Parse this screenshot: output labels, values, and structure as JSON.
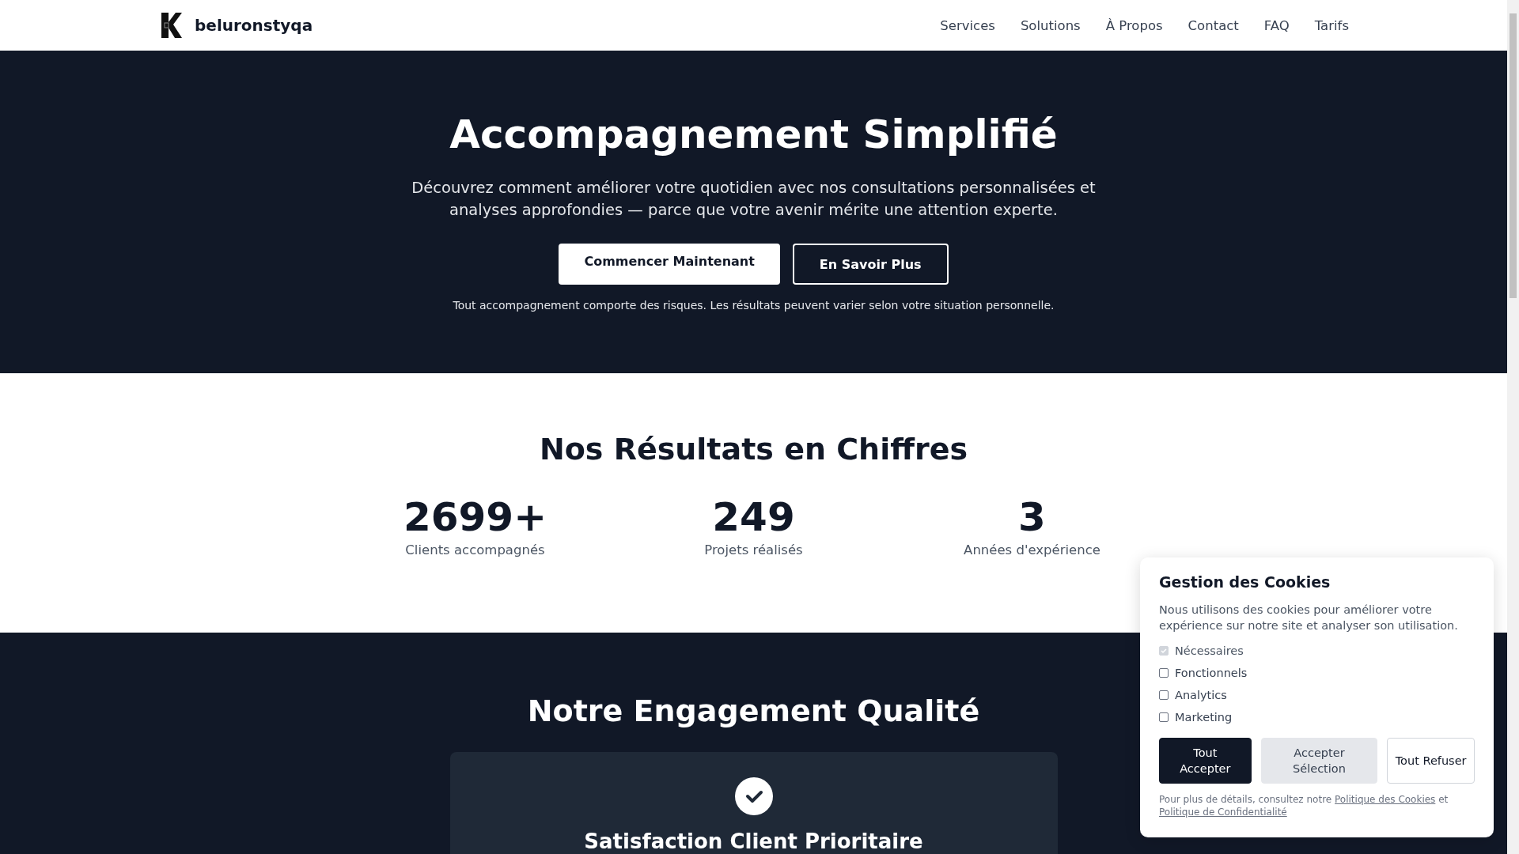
{
  "header": {
    "brand": "beluronstyqa",
    "nav": [
      "Services",
      "Solutions",
      "À Propos",
      "Contact",
      "FAQ",
      "Tarifs"
    ]
  },
  "hero": {
    "title": "Accompagnement Simplifié",
    "text": "Découvrez comment améliorer votre quotidien avec nos consultations personnalisées et analyses approfondies — parce que votre avenir mérite une attention experte.",
    "buttons": [
      {
        "label": "Commencer Maintenant",
        "kind": "primary"
      },
      {
        "label": "En Savoir Plus",
        "kind": "outline"
      }
    ],
    "disclaimer": "Tout accompagnement comporte des risques. Les résultats peuvent varier selon votre situation personnelle."
  },
  "stats": {
    "title": "Nos Résultats en Chiffres",
    "items": [
      {
        "value": "2699+",
        "label": "Clients accompagnés"
      },
      {
        "value": "249",
        "label": "Projets réalisés"
      },
      {
        "value": "3",
        "label": "Années d'expérience"
      }
    ]
  },
  "quality": {
    "title": "Notre Engagement Qualité",
    "card": {
      "title": "Satisfaction Client Prioritaire"
    }
  },
  "cookies": {
    "title": "Gestion des Cookies",
    "text": "Nous utilisons des cookies pour améliorer votre expérience sur notre site et analyser son utilisation.",
    "options": [
      {
        "label": "Nécessaires",
        "checked": true,
        "disabled": true
      },
      {
        "label": "Fonctionnels",
        "checked": false,
        "disabled": false
      },
      {
        "label": "Analytics",
        "checked": false,
        "disabled": false
      },
      {
        "label": "Marketing",
        "checked": false,
        "disabled": false
      }
    ],
    "buttons": [
      {
        "label": "Tout Accepter",
        "kind": "primary"
      },
      {
        "label": "Accepter Sélection",
        "kind": "secondary"
      },
      {
        "label": "Tout Refuser",
        "kind": "outline"
      }
    ],
    "footer": {
      "before": "Pour plus de détails, consultez notre",
      "link1": "Politique des Cookies",
      "middle": "et",
      "link2": "Politique de Confidentialité"
    }
  }
}
